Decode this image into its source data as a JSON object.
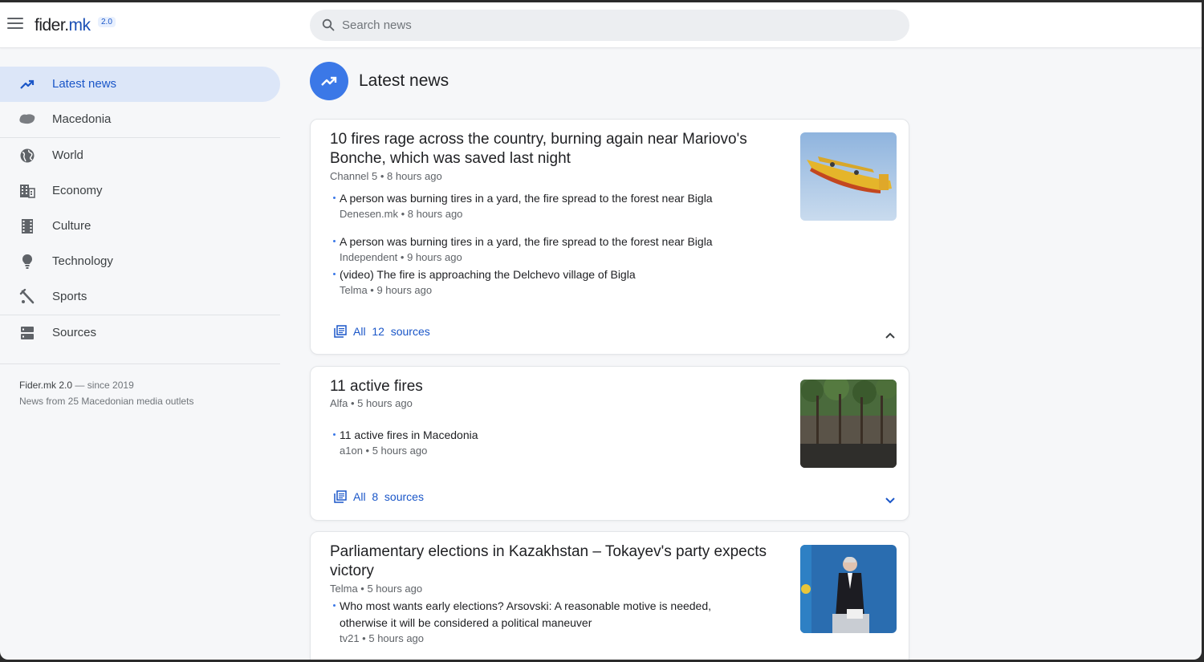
{
  "app": {
    "logo_left": "fider",
    "logo_dot": ".",
    "logo_right": "mk",
    "version": "2.0"
  },
  "search": {
    "placeholder": "Search news",
    "value": ""
  },
  "sidebar": {
    "items": [
      {
        "label": "Latest news",
        "icon": "trending-up-icon",
        "active": true
      },
      {
        "label": "Macedonia",
        "icon": "macedonia-map-icon"
      },
      {
        "label": "World",
        "icon": "globe-icon"
      },
      {
        "label": "Economy",
        "icon": "building-icon"
      },
      {
        "label": "Culture",
        "icon": "film-strip-icon"
      },
      {
        "label": "Technology",
        "icon": "lightbulb-icon"
      },
      {
        "label": "Sports",
        "icon": "sports-icon"
      },
      {
        "label": "Sources",
        "icon": "sources-icon"
      }
    ],
    "footer_brand": "Fider.mk 2.0",
    "footer_since": " — since 2019",
    "footer_desc": "News from 25 Macedonian media outlets"
  },
  "main": {
    "title": "Latest news",
    "cards": [
      {
        "title": "10 fires rage across the country, burning again near Mariovo's Bonche, which was saved last night",
        "meta": "Channel 5 • 8 hours ago",
        "subs": [
          {
            "title": "A person was burning tires in a yard, the fire spread to the forest near Bigla",
            "meta": "Denesen.mk • 8 hours ago"
          },
          {
            "title": "A person was burning tires in a yard, the fire spread to the forest near Bigla",
            "meta": "Independent • 9 hours ago"
          },
          {
            "title": "(video) The fire is approaching the Delchevo village of Bigla",
            "meta": "Telma • 9 hours ago"
          }
        ],
        "all_label": "All",
        "all_count": "12",
        "all_suffix": "sources",
        "expanded": true
      },
      {
        "title": "11 active fires",
        "meta": "Alfa • 5 hours ago",
        "subs": [
          {
            "title": "11 active fires in Macedonia",
            "meta": "a1on • 5 hours ago"
          }
        ],
        "all_label": "All",
        "all_count": "8",
        "all_suffix": "sources",
        "expanded": false
      },
      {
        "title": "Parliamentary elections in Kazakhstan – Tokayev's party expects victory",
        "meta": "Telma • 5 hours ago",
        "subs": [
          {
            "title": "Who most wants early elections? Arsovski: A reasonable motive is needed, otherwise it will be considered a political maneuver",
            "meta": "tv21 • 5 hours ago"
          }
        ]
      }
    ]
  },
  "colors": {
    "accent": "#1a56c8",
    "active_bg": "#dce6f8",
    "head_icon_bg": "#3b78e7"
  }
}
